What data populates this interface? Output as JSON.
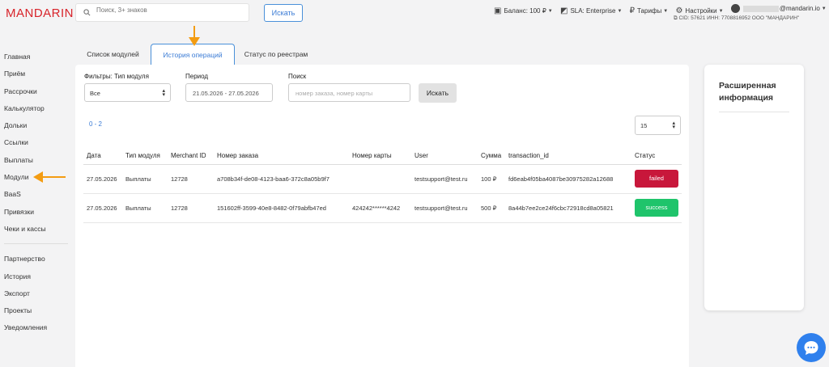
{
  "brand": {
    "logo": "MANDARIN"
  },
  "search": {
    "placeholder": "Поиск, 3+ знаков",
    "button_label": "Искать"
  },
  "topbar": {
    "balance": "Баланс: 100 ₽",
    "sla": "SLA: Enterprise",
    "tariffs": "Тарифы",
    "settings": "Настройки",
    "email_domain": "@mandarin.io",
    "org_info": "CID: 57621  ИНН: 7708816952  ООО \"МАНДАРИН\""
  },
  "sidebar": {
    "items": [
      "Главная",
      "Приём",
      "Рассрочки",
      "Калькулятор",
      "Дольки",
      "Ссылки",
      "Выплаты",
      "Модули",
      "BaaS",
      "Привязки",
      "Чеки и кассы"
    ],
    "items2": [
      "Партнерство",
      "История",
      "Экспорт",
      "Проекты",
      "Уведомления"
    ]
  },
  "tabs": [
    "Список модулей",
    "История операций",
    "Статус по реестрам"
  ],
  "filters": {
    "module_type_label": "Фильтры: Тип модуля",
    "module_type_value": "Все",
    "period_label": "Период",
    "period_value": "21.05.2026 - 27.05.2026",
    "search_label": "Поиск",
    "search_placeholder": "номер заказа, номер карты",
    "search_button": "Искать"
  },
  "pager": {
    "range": "0 - 2",
    "page_size": "15"
  },
  "table": {
    "headers": [
      "Дата",
      "Тип модуля",
      "Merchant ID",
      "Номер заказа",
      "Номер карты",
      "User",
      "Сумма",
      "transaction_id",
      "Статус"
    ],
    "rows": [
      [
        "27.05.2026",
        "Выплаты",
        "12728",
        "a708b34f-de08-4123-baa6-372c8a05b9f7",
        "",
        "testsupport@test.ru",
        "100 ₽",
        "fd6eab4f05ba4087be30975282a12688",
        "failed"
      ],
      [
        "27.05.2026",
        "Выплаты",
        "12728",
        "151602ff-3599-40e8-8482-0f79abfb47ed",
        "424242******4242",
        "testsupport@test.ru",
        "500 ₽",
        "8a44b7ee2ce24f6cbc72918cd8a05821",
        "success"
      ]
    ]
  },
  "side_panel": {
    "title": "Расширенная информация"
  },
  "colors": {
    "brand": "#d8232a",
    "accent": "#3a7bd5",
    "failed": "#c8173b",
    "success": "#1fc46b",
    "arrow": "#f39c12"
  }
}
